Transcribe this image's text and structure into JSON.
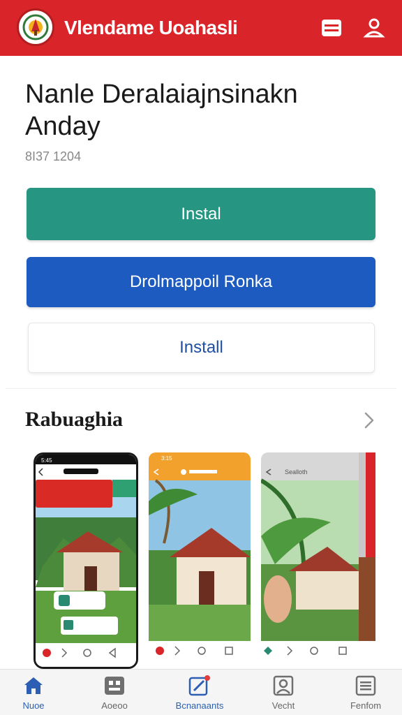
{
  "header": {
    "title": "Vlendame Uoahasli",
    "logo_icon": "emblem-icon",
    "menu_icon": "card-icon",
    "profile_icon": "user-icon",
    "brand_color": "#d9252a"
  },
  "app": {
    "name": "Nanle Deralaiajnsinakn Anday",
    "meta": "8I37 1204"
  },
  "actions": {
    "install_label": "Instal",
    "open_label": "Drolmappoil Ronka",
    "install2_label": "Install"
  },
  "screenshots": {
    "title": "Rabuaghia",
    "arrow_icon": "chevron-right-icon",
    "items": [
      {
        "status_time": "5:45",
        "banner_text": "",
        "type": "phone"
      },
      {
        "status_time": "3:15",
        "type": "app"
      },
      {
        "status_time": "",
        "header_text": "Sealloth",
        "type": "app"
      }
    ]
  },
  "bottom_nav": {
    "items": [
      {
        "label": "Nuoe",
        "icon": "home-icon",
        "active": true
      },
      {
        "label": "Aoeoo",
        "icon": "apps-icon",
        "active": false
      },
      {
        "label": "Bcnanaants",
        "icon": "edit-icon",
        "active": false,
        "badge": true
      },
      {
        "label": "Vecht",
        "icon": "portrait-icon",
        "active": false
      },
      {
        "label": "Fenfom",
        "icon": "list-icon",
        "active": false
      }
    ]
  }
}
